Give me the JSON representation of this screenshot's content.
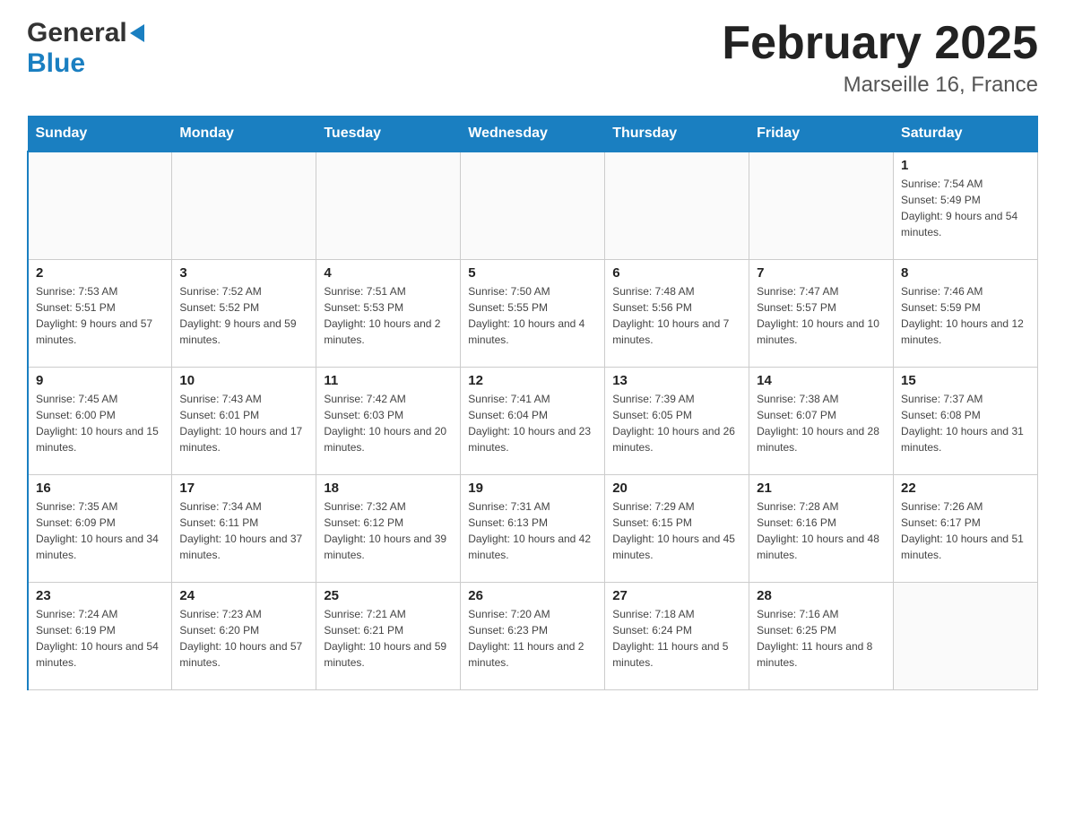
{
  "logo": {
    "general": "General",
    "blue": "Blue"
  },
  "header": {
    "month": "February 2025",
    "location": "Marseille 16, France"
  },
  "weekdays": [
    "Sunday",
    "Monday",
    "Tuesday",
    "Wednesday",
    "Thursday",
    "Friday",
    "Saturday"
  ],
  "weeks": [
    [
      {
        "day": "",
        "info": ""
      },
      {
        "day": "",
        "info": ""
      },
      {
        "day": "",
        "info": ""
      },
      {
        "day": "",
        "info": ""
      },
      {
        "day": "",
        "info": ""
      },
      {
        "day": "",
        "info": ""
      },
      {
        "day": "1",
        "info": "Sunrise: 7:54 AM\nSunset: 5:49 PM\nDaylight: 9 hours and 54 minutes."
      }
    ],
    [
      {
        "day": "2",
        "info": "Sunrise: 7:53 AM\nSunset: 5:51 PM\nDaylight: 9 hours and 57 minutes."
      },
      {
        "day": "3",
        "info": "Sunrise: 7:52 AM\nSunset: 5:52 PM\nDaylight: 9 hours and 59 minutes."
      },
      {
        "day": "4",
        "info": "Sunrise: 7:51 AM\nSunset: 5:53 PM\nDaylight: 10 hours and 2 minutes."
      },
      {
        "day": "5",
        "info": "Sunrise: 7:50 AM\nSunset: 5:55 PM\nDaylight: 10 hours and 4 minutes."
      },
      {
        "day": "6",
        "info": "Sunrise: 7:48 AM\nSunset: 5:56 PM\nDaylight: 10 hours and 7 minutes."
      },
      {
        "day": "7",
        "info": "Sunrise: 7:47 AM\nSunset: 5:57 PM\nDaylight: 10 hours and 10 minutes."
      },
      {
        "day": "8",
        "info": "Sunrise: 7:46 AM\nSunset: 5:59 PM\nDaylight: 10 hours and 12 minutes."
      }
    ],
    [
      {
        "day": "9",
        "info": "Sunrise: 7:45 AM\nSunset: 6:00 PM\nDaylight: 10 hours and 15 minutes."
      },
      {
        "day": "10",
        "info": "Sunrise: 7:43 AM\nSunset: 6:01 PM\nDaylight: 10 hours and 17 minutes."
      },
      {
        "day": "11",
        "info": "Sunrise: 7:42 AM\nSunset: 6:03 PM\nDaylight: 10 hours and 20 minutes."
      },
      {
        "day": "12",
        "info": "Sunrise: 7:41 AM\nSunset: 6:04 PM\nDaylight: 10 hours and 23 minutes."
      },
      {
        "day": "13",
        "info": "Sunrise: 7:39 AM\nSunset: 6:05 PM\nDaylight: 10 hours and 26 minutes."
      },
      {
        "day": "14",
        "info": "Sunrise: 7:38 AM\nSunset: 6:07 PM\nDaylight: 10 hours and 28 minutes."
      },
      {
        "day": "15",
        "info": "Sunrise: 7:37 AM\nSunset: 6:08 PM\nDaylight: 10 hours and 31 minutes."
      }
    ],
    [
      {
        "day": "16",
        "info": "Sunrise: 7:35 AM\nSunset: 6:09 PM\nDaylight: 10 hours and 34 minutes."
      },
      {
        "day": "17",
        "info": "Sunrise: 7:34 AM\nSunset: 6:11 PM\nDaylight: 10 hours and 37 minutes."
      },
      {
        "day": "18",
        "info": "Sunrise: 7:32 AM\nSunset: 6:12 PM\nDaylight: 10 hours and 39 minutes."
      },
      {
        "day": "19",
        "info": "Sunrise: 7:31 AM\nSunset: 6:13 PM\nDaylight: 10 hours and 42 minutes."
      },
      {
        "day": "20",
        "info": "Sunrise: 7:29 AM\nSunset: 6:15 PM\nDaylight: 10 hours and 45 minutes."
      },
      {
        "day": "21",
        "info": "Sunrise: 7:28 AM\nSunset: 6:16 PM\nDaylight: 10 hours and 48 minutes."
      },
      {
        "day": "22",
        "info": "Sunrise: 7:26 AM\nSunset: 6:17 PM\nDaylight: 10 hours and 51 minutes."
      }
    ],
    [
      {
        "day": "23",
        "info": "Sunrise: 7:24 AM\nSunset: 6:19 PM\nDaylight: 10 hours and 54 minutes."
      },
      {
        "day": "24",
        "info": "Sunrise: 7:23 AM\nSunset: 6:20 PM\nDaylight: 10 hours and 57 minutes."
      },
      {
        "day": "25",
        "info": "Sunrise: 7:21 AM\nSunset: 6:21 PM\nDaylight: 10 hours and 59 minutes."
      },
      {
        "day": "26",
        "info": "Sunrise: 7:20 AM\nSunset: 6:23 PM\nDaylight: 11 hours and 2 minutes."
      },
      {
        "day": "27",
        "info": "Sunrise: 7:18 AM\nSunset: 6:24 PM\nDaylight: 11 hours and 5 minutes."
      },
      {
        "day": "28",
        "info": "Sunrise: 7:16 AM\nSunset: 6:25 PM\nDaylight: 11 hours and 8 minutes."
      },
      {
        "day": "",
        "info": ""
      }
    ]
  ]
}
